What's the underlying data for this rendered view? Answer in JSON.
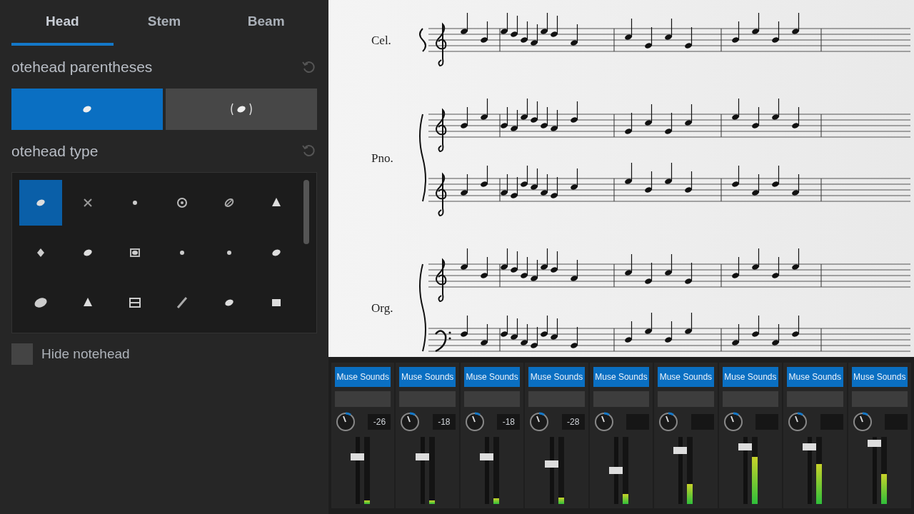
{
  "properties": {
    "tabs": [
      {
        "label": "Head",
        "selected": true
      },
      {
        "label": "Stem",
        "selected": false
      },
      {
        "label": "Beam",
        "selected": false
      }
    ],
    "parentheses": {
      "title": "otehead parentheses",
      "options": [
        {
          "kind": "plain",
          "selected": true
        },
        {
          "kind": "parenthesized",
          "selected": false
        }
      ]
    },
    "notehead_type": {
      "title": "otehead type",
      "cells": [
        {
          "kind": "oval",
          "selected": true
        },
        {
          "kind": "cross",
          "selected": false
        },
        {
          "kind": "dot",
          "selected": false
        },
        {
          "kind": "circled",
          "selected": false
        },
        {
          "kind": "slashed",
          "selected": false
        },
        {
          "kind": "triangle",
          "selected": false
        },
        {
          "kind": "diamond",
          "selected": false
        },
        {
          "kind": "oval",
          "selected": false
        },
        {
          "kind": "boxed",
          "selected": false
        },
        {
          "kind": "dot",
          "selected": false
        },
        {
          "kind": "dot",
          "selected": false
        },
        {
          "kind": "oval",
          "selected": false
        },
        {
          "kind": "large",
          "selected": false
        },
        {
          "kind": "triangle",
          "selected": false
        },
        {
          "kind": "bracket",
          "selected": false
        },
        {
          "kind": "slash",
          "selected": false
        },
        {
          "kind": "oval",
          "selected": false
        },
        {
          "kind": "square",
          "selected": false
        }
      ]
    },
    "hide_notehead": {
      "label": "Hide notehead",
      "checked": false
    }
  },
  "score": {
    "instruments": [
      {
        "name": "Cel.",
        "staves": [
          {
            "kind": "treble"
          }
        ]
      },
      {
        "name": "Pno.",
        "staves": [
          {
            "kind": "treble"
          },
          {
            "kind": "treble"
          }
        ]
      },
      {
        "name": "Org.",
        "staves": [
          {
            "kind": "treble"
          },
          {
            "kind": "bass"
          }
        ]
      }
    ]
  },
  "mixer": {
    "strips": [
      {
        "label": "Muse Sounds",
        "reading": "-26",
        "meter": {
          "level": 0.05
        },
        "fader": {
          "level": 0.7
        }
      },
      {
        "label": "Muse Sounds",
        "reading": "-18",
        "meter": {
          "level": 0.05
        },
        "fader": {
          "level": 0.7
        }
      },
      {
        "label": "Muse Sounds",
        "reading": "-18",
        "meter": {
          "level": 0.08
        },
        "fader": {
          "level": 0.7
        }
      },
      {
        "label": "Muse Sounds",
        "reading": "-28",
        "meter": {
          "level": 0.1
        },
        "fader": {
          "level": 0.6
        }
      },
      {
        "label": "Muse Sounds",
        "meter": {
          "level": 0.15
        },
        "fader": {
          "level": 0.5
        }
      },
      {
        "label": "Muse Sounds",
        "meter": {
          "level": 0.3
        },
        "fader": {
          "level": 0.8
        }
      },
      {
        "label": "Muse Sounds",
        "meter": {
          "level": 0.7
        },
        "fader": {
          "level": 0.85
        }
      },
      {
        "label": "Muse Sounds",
        "meter": {
          "level": 0.6
        },
        "fader": {
          "level": 0.85
        }
      },
      {
        "label": "Muse Sounds",
        "meter": {
          "level": 0.45
        },
        "fader": {
          "level": 0.9
        }
      }
    ]
  }
}
